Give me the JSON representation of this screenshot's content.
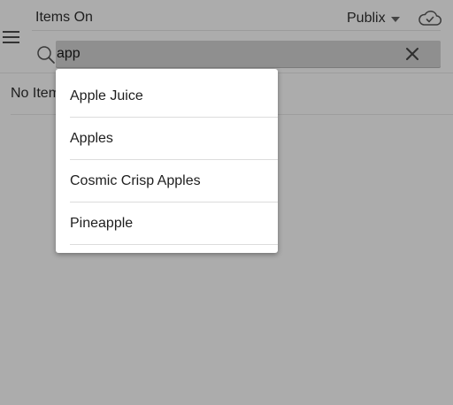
{
  "header": {
    "title": "Items On",
    "store": "Publix"
  },
  "search": {
    "value": "app"
  },
  "list": {
    "empty_text": "No Items"
  },
  "suggestions": [
    {
      "label": "Apple Juice"
    },
    {
      "label": "Apples"
    },
    {
      "label": "Cosmic Crisp Apples"
    },
    {
      "label": "Pineapple"
    }
  ],
  "icons": {
    "menu": "hamburger-menu-icon",
    "store_dropdown": "caret-down-icon",
    "sync": "cloud-check-icon",
    "search": "search-icon",
    "clear": "close-icon"
  },
  "colors": {
    "overlay_background": "#acacac",
    "search_field": "#8f8f8f",
    "dropdown": "#ffffff"
  }
}
